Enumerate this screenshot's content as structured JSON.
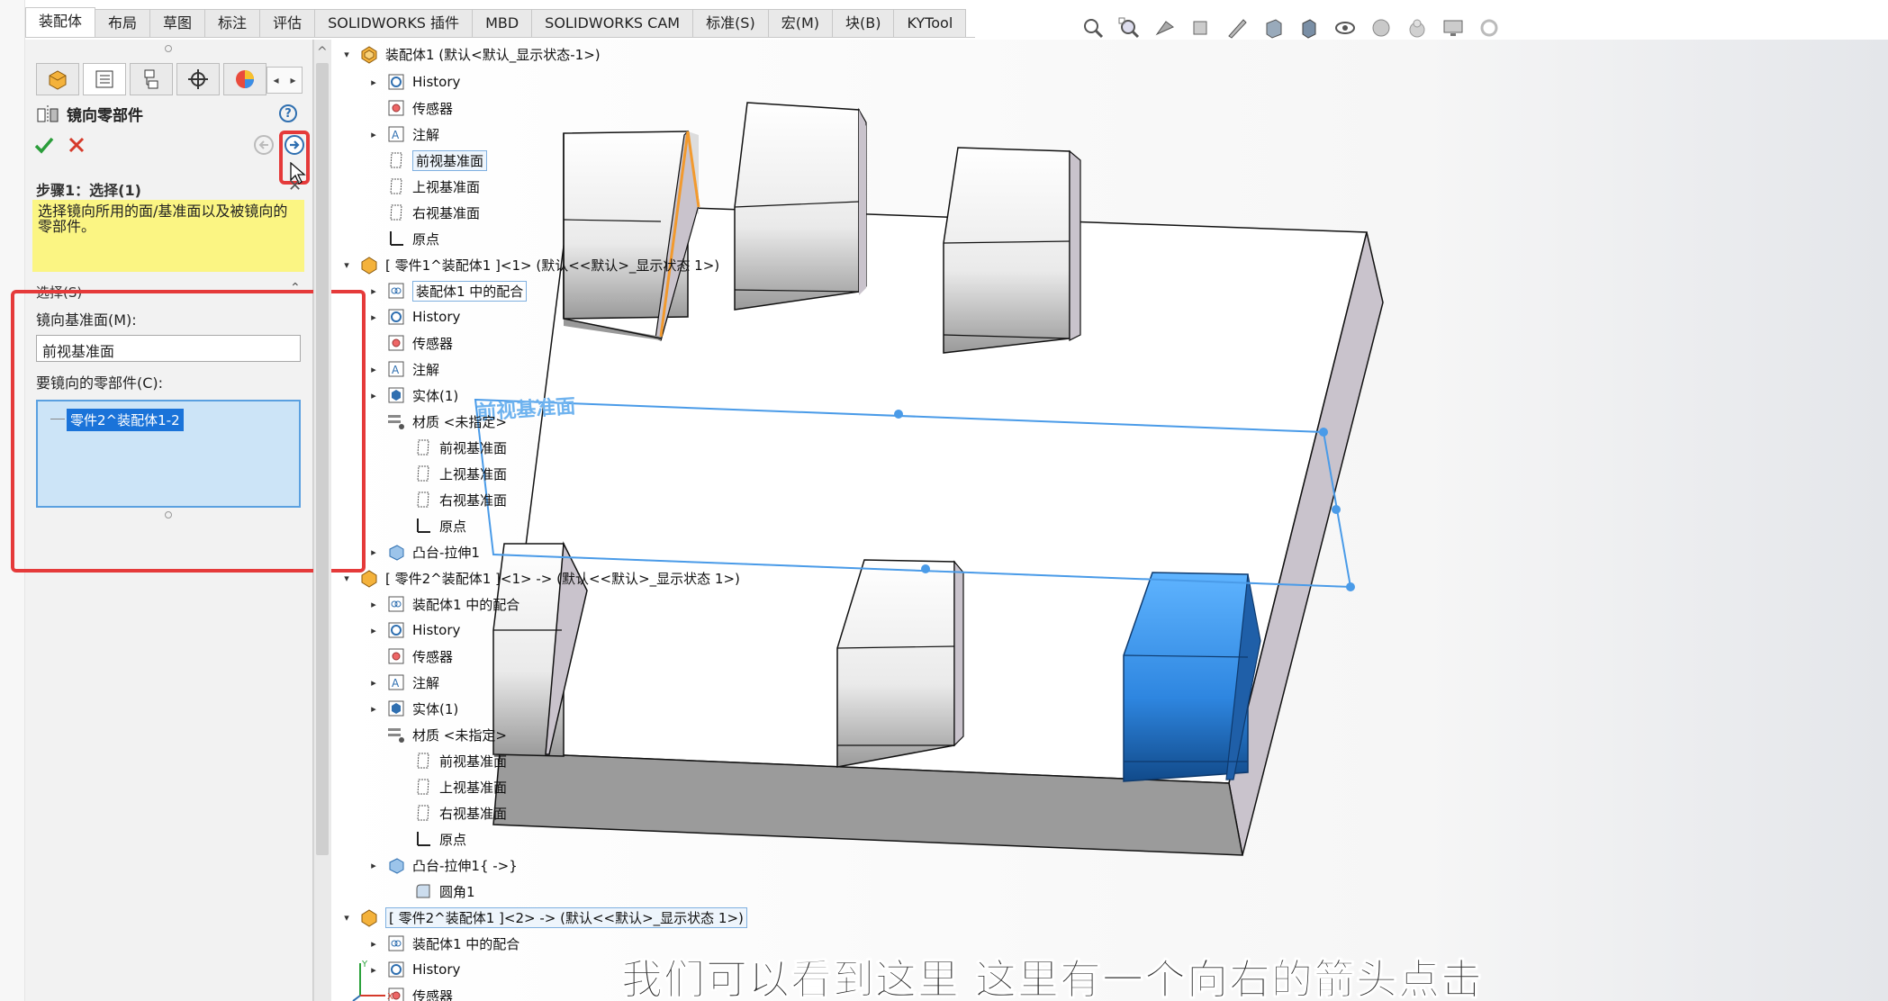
{
  "command_tabs": [
    "装配体",
    "布局",
    "草图",
    "标注",
    "评估",
    "SOLIDWORKS 插件",
    "MBD",
    "SOLIDWORKS CAM",
    "标准(S)",
    "宏(M)",
    "块(B)",
    "KYTool"
  ],
  "active_command_tab": "装配体",
  "hud_toolbar_icons": [
    "zoom-to-fit-icon",
    "zoom-area-icon",
    "previous-view-icon",
    "section-view-icon",
    "dynamic-annotation-icon",
    "view-orientation-icon",
    "display-style-icon",
    "hide-show-items-icon",
    "edit-appearance-icon",
    "apply-scene-icon",
    "view-settings-icon",
    "rotate-icon"
  ],
  "property_manager": {
    "tab_icons": [
      "feature-manager-icon",
      "property-manager-icon",
      "configuration-manager-icon",
      "dimxpert-icon",
      "display-manager-icon"
    ],
    "title": "镜向零部件",
    "help_icon": "?",
    "step_title": "步骤1：选择(1)",
    "step_message": "选择镜向所用的面/基准面以及被镜向的零部件。",
    "selection_section": "选择(S)",
    "mirror_plane_label": "镜向基准面(M):",
    "mirror_plane_value": "前视基准面",
    "components_label": "要镜向的零部件(C):",
    "components": [
      "零件2^装配体1-2"
    ]
  },
  "feature_tree": {
    "root": "装配体1  (默认<默认_显示状态-1>)",
    "items": [
      {
        "label": "History",
        "icon": "history-icon"
      },
      {
        "label": "传感器",
        "icon": "sensor-icon"
      },
      {
        "label": "注解",
        "icon": "annotation-icon"
      },
      {
        "label": "前视基准面",
        "icon": "plane-icon"
      },
      {
        "label": "上视基准面",
        "icon": "plane-icon"
      },
      {
        "label": "右视基准面",
        "icon": "plane-icon"
      },
      {
        "label": "原点",
        "icon": "origin-icon"
      },
      {
        "label": "[ 零件1^装配体1 ]<1> (默认<<默认>_显示状态 1>)",
        "icon": "part-icon"
      },
      {
        "label": "装配体1 中的配合",
        "icon": "mates-icon"
      },
      {
        "label": "History",
        "icon": "history-icon"
      },
      {
        "label": "传感器",
        "icon": "sensor-icon"
      },
      {
        "label": "注解",
        "icon": "annotation-icon"
      },
      {
        "label": "实体(1)",
        "icon": "solid-body-icon"
      },
      {
        "label": "材质 <未指定>",
        "icon": "material-icon"
      },
      {
        "label": "前视基准面",
        "icon": "plane-icon"
      },
      {
        "label": "上视基准面",
        "icon": "plane-icon"
      },
      {
        "label": "右视基准面",
        "icon": "plane-icon"
      },
      {
        "label": "原点",
        "icon": "origin-icon"
      },
      {
        "label": "凸台-拉伸1",
        "icon": "extrude-icon"
      },
      {
        "label": "[ 零件2^装配体1 ]<1> -> (默认<<默认>_显示状态 1>)",
        "icon": "part-icon"
      },
      {
        "label": "装配体1 中的配合",
        "icon": "mates-icon"
      },
      {
        "label": "History",
        "icon": "history-icon"
      },
      {
        "label": "传感器",
        "icon": "sensor-icon"
      },
      {
        "label": "注解",
        "icon": "annotation-icon"
      },
      {
        "label": "实体(1)",
        "icon": "solid-body-icon"
      },
      {
        "label": "材质 <未指定>",
        "icon": "material-icon"
      },
      {
        "label": "前视基准面",
        "icon": "plane-icon"
      },
      {
        "label": "上视基准面",
        "icon": "plane-icon"
      },
      {
        "label": "右视基准面",
        "icon": "plane-icon"
      },
      {
        "label": "原点",
        "icon": "origin-icon"
      },
      {
        "label": "凸台-拉伸1{ ->}",
        "icon": "extrude-icon"
      },
      {
        "label": "圆角1",
        "icon": "fillet-icon"
      },
      {
        "label": "[ 零件2^装配体1 ]<2> -> (默认<<默认>_显示状态 1>)",
        "icon": "part-icon"
      },
      {
        "label": "装配体1 中的配合",
        "icon": "mates-icon"
      },
      {
        "label": "History",
        "icon": "history-icon"
      },
      {
        "label": "传感器",
        "icon": "sensor-icon"
      }
    ]
  },
  "viewport": {
    "plane_label": "前视基准面",
    "highlight_color": "#e53a3a",
    "selection_color": "#3fa3f5",
    "edge_highlight_color": "#f29a2e"
  },
  "subtitle": "我们可以看到这里 这里有一个向右的箭头点击"
}
